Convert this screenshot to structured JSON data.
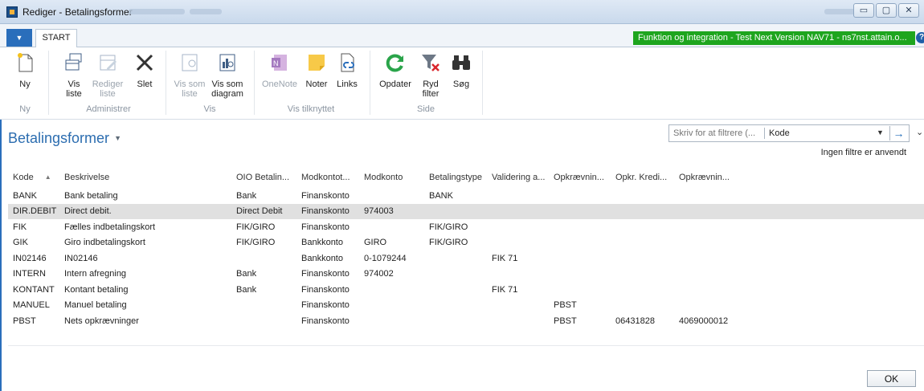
{
  "window": {
    "title": "Rediger - Betalingsformer",
    "buttons": {
      "minimize": "▭",
      "maximize": "▢",
      "close": "✕"
    }
  },
  "tabs": {
    "start": "START"
  },
  "environment_banner": "Funktion og integration - Test Next Version NAV71 - ns7nst.attain.o...",
  "help": "?",
  "ribbon": {
    "ny": "Ny",
    "vis_liste": "Vis\nliste",
    "rediger_liste": "Rediger\nliste",
    "slet": "Slet",
    "vis_som_liste": "Vis som\nliste",
    "vis_som_diagram": "Vis som\ndiagram",
    "onenote": "OneNote",
    "noter": "Noter",
    "links": "Links",
    "opdater": "Opdater",
    "ryd_filter": "Ryd\nfilter",
    "sog": "Søg",
    "groups": {
      "ny": "Ny",
      "administrer": "Administrer",
      "vis": "Vis",
      "vis_tilknyttet": "Vis tilknyttet",
      "side": "Side"
    }
  },
  "page": {
    "title": "Betalingsformer",
    "filter_placeholder": "Skriv for at filtrere (...",
    "filter_field": "Kode",
    "no_filters": "Ingen filtre er anvendt"
  },
  "table": {
    "columns": [
      "Kode",
      "Beskrivelse",
      "OIO Betalin...",
      "Modkontot...",
      "Modkonto",
      "Betalingstype",
      "Validering a...",
      "Opkrævnin...",
      "Opkr. Kredi...",
      "Opkrævnin..."
    ],
    "rows": [
      [
        "BANK",
        "Bank betaling",
        "Bank",
        "Finanskonto",
        "",
        "BANK",
        "",
        "",
        "",
        ""
      ],
      [
        "DIR.DEBIT",
        "Direct debit.",
        "Direct Debit",
        "Finanskonto",
        "974003",
        "",
        "",
        "",
        "",
        ""
      ],
      [
        "FIK",
        "Fælles indbetalingskort",
        "FIK/GIRO",
        "Finanskonto",
        "",
        "FIK/GIRO",
        "",
        "",
        "",
        ""
      ],
      [
        "GIK",
        "Giro indbetalingskort",
        "FIK/GIRO",
        "Bankkonto",
        "GIRO",
        "FIK/GIRO",
        "",
        "",
        "",
        ""
      ],
      [
        "IN02146",
        "IN02146",
        "",
        "Bankkonto",
        "0-1079244",
        "",
        "FIK 71",
        "",
        "",
        ""
      ],
      [
        "INTERN",
        "Intern afregning",
        "Bank",
        "Finanskonto",
        "974002",
        "",
        "",
        "",
        "",
        ""
      ],
      [
        "KONTANT",
        "Kontant betaling",
        "Bank",
        "Finanskonto",
        "",
        "",
        "FIK 71",
        "",
        "",
        ""
      ],
      [
        "MANUEL",
        "Manuel betaling",
        "",
        "Finanskonto",
        "",
        "",
        "",
        "PBST",
        "",
        ""
      ],
      [
        "PBST",
        "Nets opkrævninger",
        "",
        "Finanskonto",
        "",
        "",
        "",
        "PBST",
        "06431828",
        "4069000012"
      ]
    ]
  },
  "ok": "OK",
  "colors": {
    "accent": "#2c6db0",
    "banner": "#1ea51e",
    "selected_row": "#e0e0e0"
  }
}
